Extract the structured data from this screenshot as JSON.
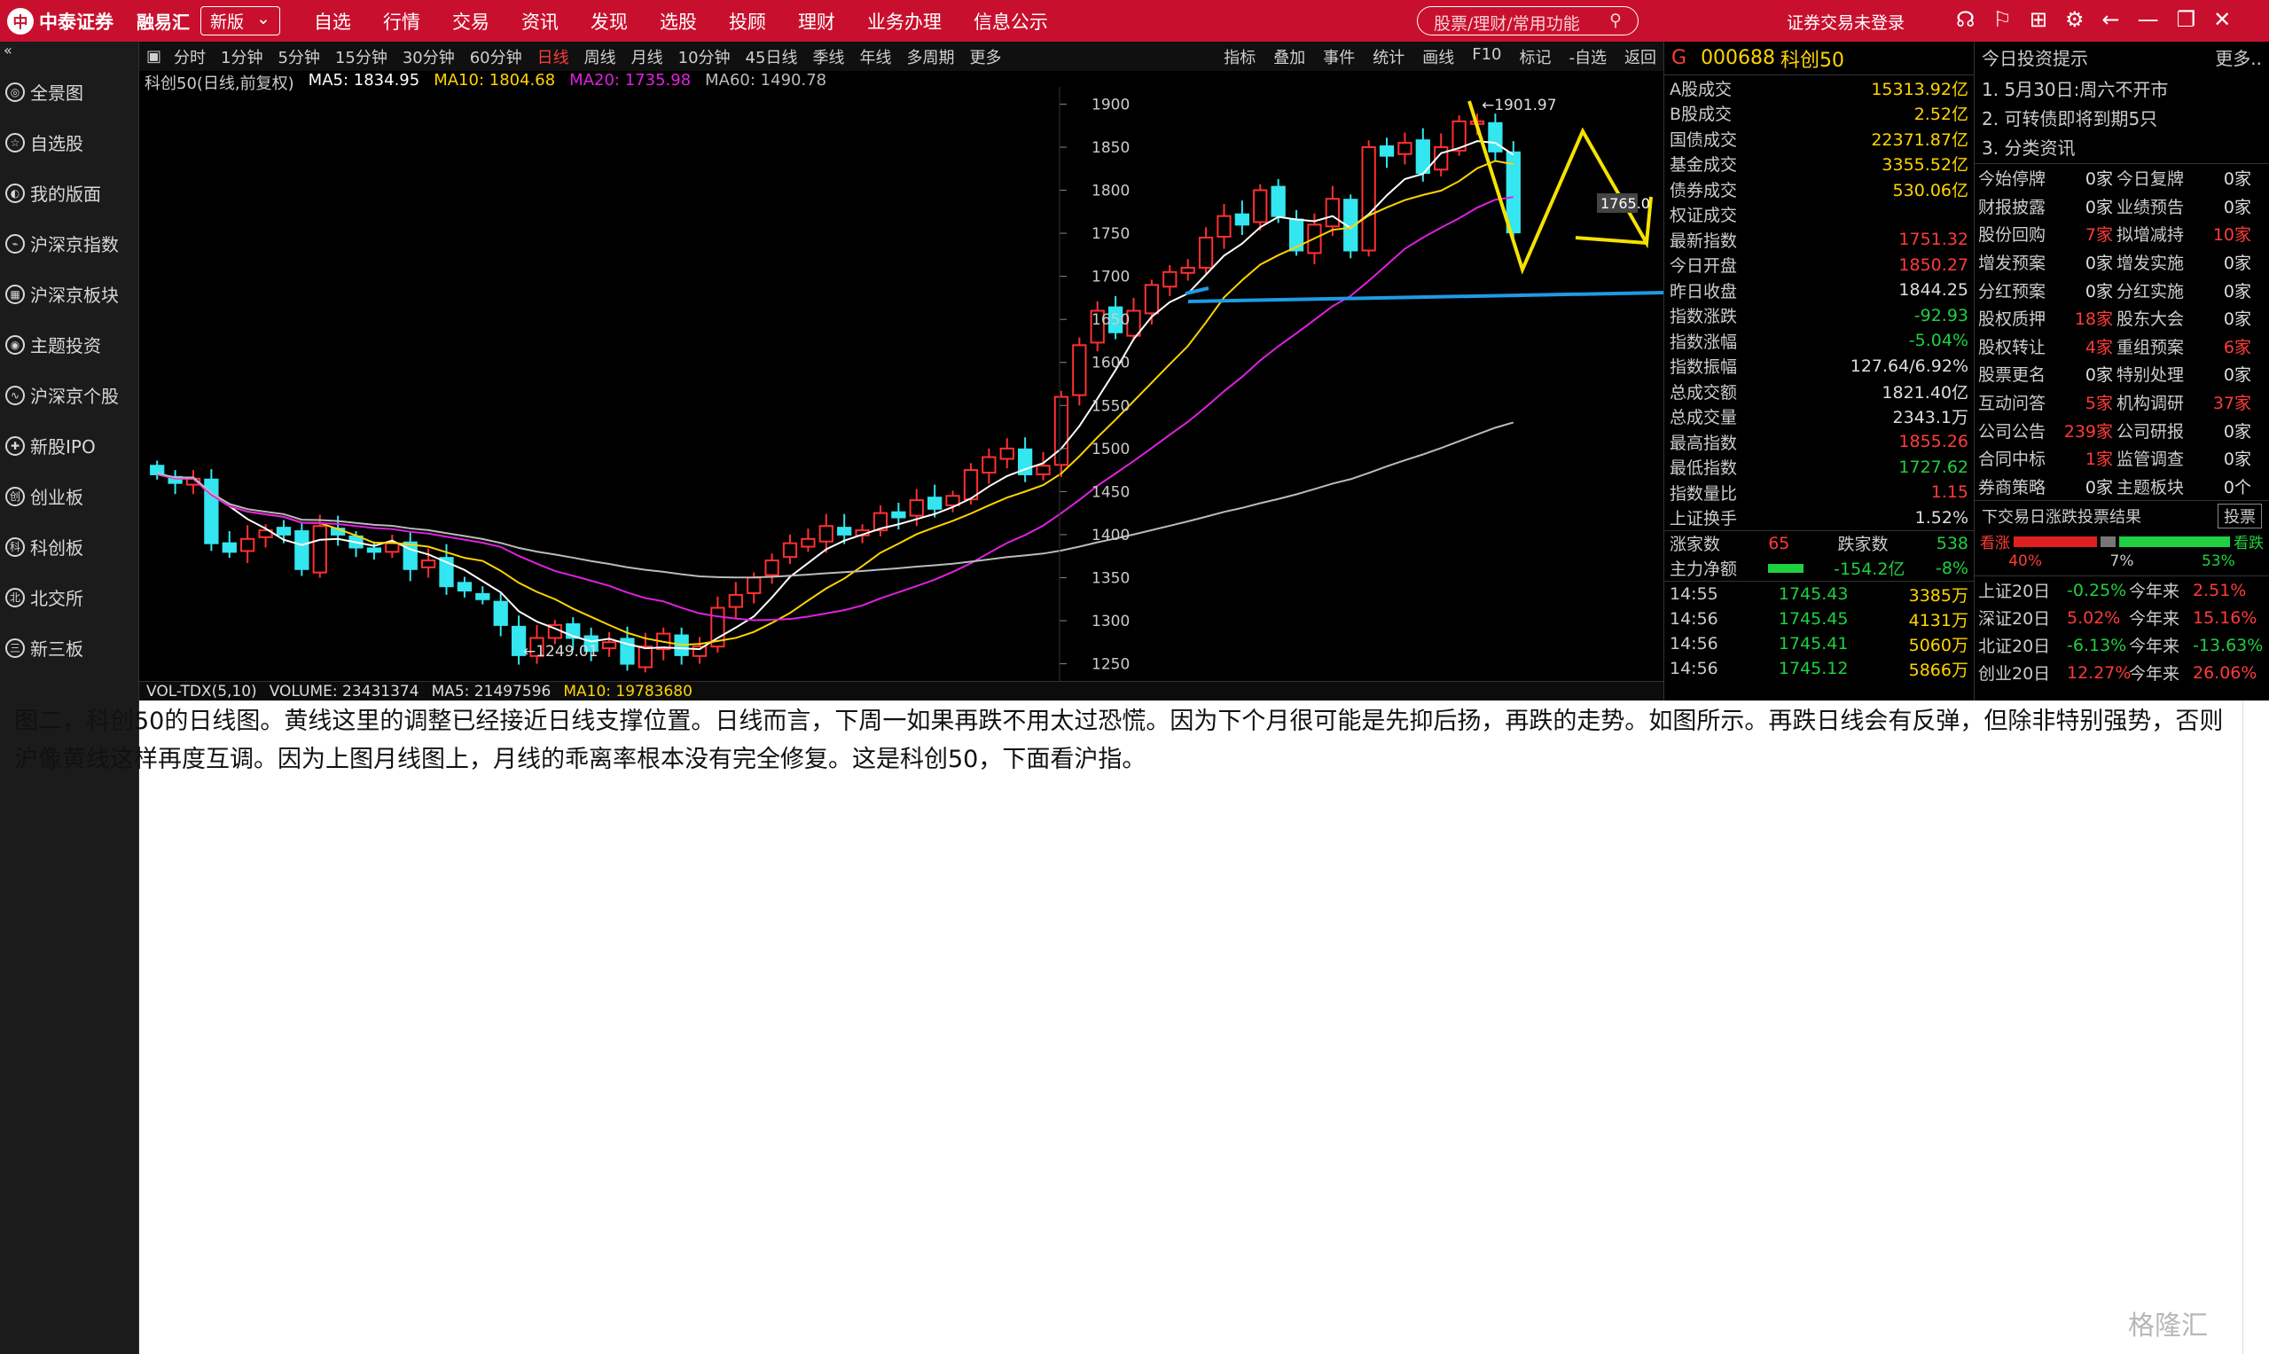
{
  "app": {
    "brand": "中泰证券",
    "brand_sub": "融易汇",
    "version": "新版",
    "menu": [
      "自选",
      "行情",
      "交易",
      "资讯",
      "发现",
      "选股",
      "投顾",
      "理财",
      "业务办理",
      "信息公示"
    ],
    "search_placeholder": "股票/理财/常用功能",
    "login": "证券交易未登录"
  },
  "nav": [
    "全景图",
    "自选股",
    "我的版面",
    "沪深京指数",
    "沪深京板块",
    "主题投资",
    "沪深京个股",
    "新股IPO",
    "创业板",
    "科创板",
    "北交所",
    "新三板"
  ],
  "periods": [
    "分时",
    "1分钟",
    "5分钟",
    "15分钟",
    "30分钟",
    "60分钟",
    "日线",
    "周线",
    "月线",
    "10分钟",
    "45日线",
    "季线",
    "年线",
    "多周期",
    "更多"
  ],
  "active_period": "日线",
  "tools": [
    "指标",
    "叠加",
    "事件",
    "统计",
    "画线",
    "F10",
    "标记",
    "-自选",
    "返回"
  ],
  "ma": {
    "name": "科创50(日线,前复权)",
    "ma5": "MA5: 1834.95",
    "ma10": "MA10: 1804.68",
    "ma20": "MA20: 1735.98",
    "ma60": "MA60: 1490.78"
  },
  "vol": {
    "name": "VOL-TDX(5,10)",
    "volume": "VOLUME: 23431374",
    "ma5": "MA5: 21497596",
    "ma10": "MA10: 19783680"
  },
  "chart_data": {
    "type": "candlestick",
    "y_ticks": [
      1250,
      1300,
      1350,
      1400,
      1450,
      1500,
      1550,
      1600,
      1650,
      1700,
      1750,
      1800,
      1850,
      1900
    ],
    "ylim": [
      1230,
      1920
    ],
    "annotations": [
      "1901.97",
      "←1249.01",
      "1765.0"
    ],
    "closes": [
      1470,
      1460,
      1465,
      1390,
      1380,
      1395,
      1405,
      1400,
      1360,
      1410,
      1400,
      1385,
      1380,
      1390,
      1360,
      1370,
      1340,
      1335,
      1325,
      1295,
      1260,
      1280,
      1295,
      1280,
      1265,
      1275,
      1250,
      1270,
      1285,
      1260,
      1270,
      1315,
      1330,
      1350,
      1370,
      1390,
      1395,
      1410,
      1400,
      1405,
      1425,
      1420,
      1440,
      1430,
      1445,
      1475,
      1490,
      1500,
      1470,
      1480,
      1560,
      1620,
      1660,
      1635,
      1660,
      1690,
      1705,
      1710,
      1745,
      1770,
      1760,
      1800,
      1770,
      1730,
      1760,
      1790,
      1730,
      1850,
      1840,
      1855,
      1820,
      1850,
      1880,
      1880,
      1845,
      1751
    ]
  },
  "quote": {
    "code": "000688",
    "name": "科创50",
    "rows": [
      [
        "A股成交",
        "15313.92亿"
      ],
      [
        "B股成交",
        "2.52亿"
      ],
      [
        "国债成交",
        "22371.87亿"
      ],
      [
        "基金成交",
        "3355.52亿"
      ],
      [
        "债券成交",
        "530.06亿"
      ],
      [
        "权证成交",
        ""
      ],
      [
        "最新指数",
        "1751.32"
      ],
      [
        "今日开盘",
        "1850.27"
      ],
      [
        "昨日收盘",
        "1844.25"
      ],
      [
        "指数涨跌",
        "-92.93"
      ],
      [
        "指数涨幅",
        "-5.04%"
      ],
      [
        "指数振幅",
        "127.64/6.92%"
      ],
      [
        "总成交额",
        "1821.40亿"
      ],
      [
        "总成交量",
        "2343.1万"
      ],
      [
        "最高指数",
        "1855.26"
      ],
      [
        "最低指数",
        "1727.62"
      ],
      [
        "指数量比",
        "1.15"
      ],
      [
        "上证换手",
        "1.52%"
      ]
    ],
    "up_label": "涨家数",
    "up": "65",
    "down_label": "跌家数",
    "down": "538",
    "flow_label": "主力净额",
    "flow": "-154.2亿",
    "flow_pct": "-8%",
    "ticks": [
      [
        "14:55",
        "1745.43",
        "3385万"
      ],
      [
        "14:56",
        "1745.45",
        "4131万"
      ],
      [
        "14:56",
        "1745.41",
        "5060万"
      ],
      [
        "14:56",
        "1745.12",
        "5866万"
      ]
    ]
  },
  "info": {
    "title": "今日投资提示",
    "more": "更多..",
    "tips": [
      "1. 5月30日:周六不开市",
      "2. 可转债即将到期5只",
      "3. 分类资讯"
    ],
    "counts": [
      [
        "今始停牌",
        "0家",
        "今日复牌",
        "0家"
      ],
      [
        "财报披露",
        "0家",
        "业绩预告",
        "0家"
      ],
      [
        "股份回购",
        "7家",
        "拟增减持",
        "10家"
      ],
      [
        "增发预案",
        "0家",
        "增发实施",
        "0家"
      ],
      [
        "分红预案",
        "0家",
        "分红实施",
        "0家"
      ],
      [
        "股权质押",
        "18家",
        "股东大会",
        "0家"
      ],
      [
        "股权转让",
        "4家",
        "重组预案",
        "6家"
      ],
      [
        "股票更名",
        "0家",
        "特别处理",
        "0家"
      ],
      [
        "互动问答",
        "5家",
        "机构调研",
        "37家"
      ],
      [
        "公司公告",
        "239家",
        "公司研报",
        "0家"
      ],
      [
        "合同中标",
        "1家",
        "监管调查",
        "0家"
      ],
      [
        "券商策略",
        "0家",
        "主题板块",
        "0个"
      ]
    ],
    "vote_title": "下交易日涨跌投票结果",
    "vote_btn": "投票",
    "bull": "看涨",
    "bear": "看跌",
    "pcts": [
      "40%",
      "7%",
      "53%"
    ],
    "ranks": [
      [
        "上证20日",
        "-0.25%",
        "今年来",
        "2.51%"
      ],
      [
        "深证20日",
        "5.02%",
        "今年来",
        "15.16%"
      ],
      [
        "北证20日",
        "-6.13%",
        "今年来",
        "-13.63%"
      ],
      [
        "创业20日",
        "12.27%",
        "今年来",
        "26.06%"
      ]
    ]
  },
  "caption": "图二，科创50的日线图。黄线这里的调整已经接近日线支撑位置。日线而言，下周一如果再跌不用太过恐慌。因为下个月很可能是先抑后扬，再跌的走势。如图所示。再跌日线会有反弹，但除非特别强势，否则沪像黄线这样再度互调。因为上图月线图上，月线的乖离率根本没有完全修复。这是科创50，下面看沪指。",
  "watermark": "格隆汇"
}
